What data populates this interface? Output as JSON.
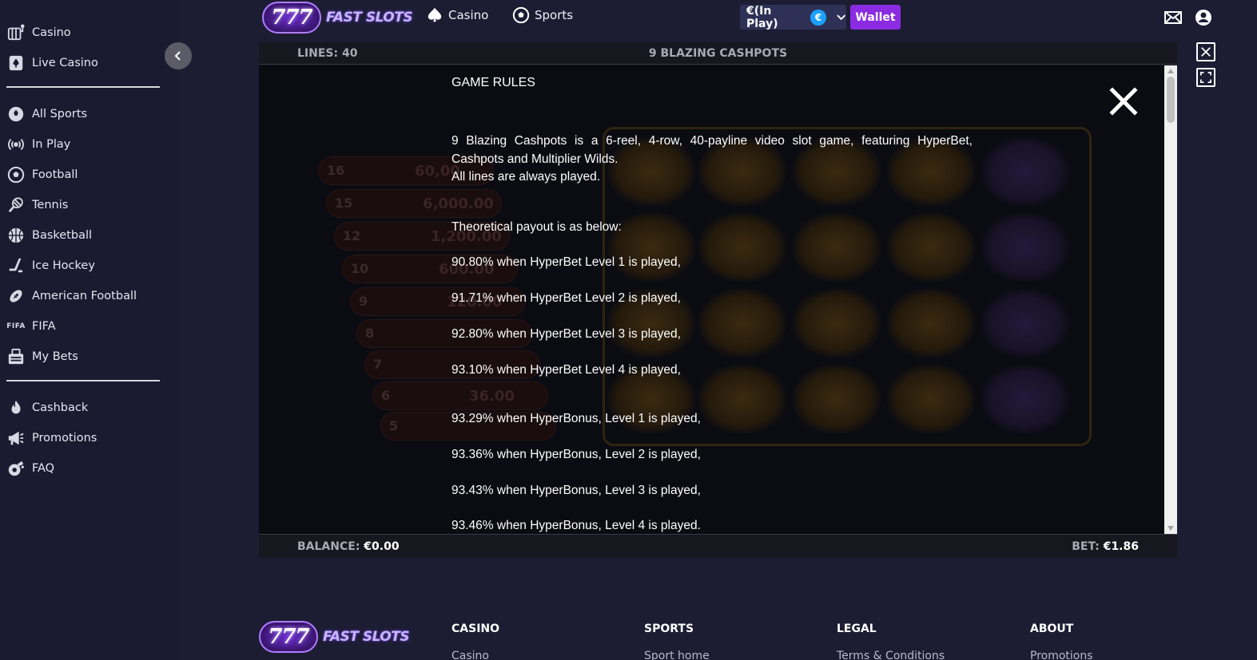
{
  "brand": {
    "logo_number": "777",
    "logo_text": "FAST SLOTS"
  },
  "sidebar": {
    "group1": [
      {
        "label": "Casino",
        "icon": "casino-icon"
      },
      {
        "label": "Live Casino",
        "icon": "live-casino-icon"
      }
    ],
    "group2": [
      {
        "label": "All Sports",
        "icon": "all-sports-icon"
      },
      {
        "label": "In Play",
        "icon": "in-play-icon"
      },
      {
        "label": "Football",
        "icon": "football-icon"
      },
      {
        "label": "Tennis",
        "icon": "tennis-icon"
      },
      {
        "label": "Basketball",
        "icon": "basketball-icon"
      },
      {
        "label": "Ice Hockey",
        "icon": "ice-hockey-icon"
      },
      {
        "label": "American Football",
        "icon": "american-football-icon"
      },
      {
        "label": "FIFA",
        "icon": "fifa-icon"
      },
      {
        "label": "My Bets",
        "icon": "my-bets-icon"
      }
    ],
    "group3": [
      {
        "label": "Cashback",
        "icon": "cashback-icon"
      },
      {
        "label": "Promotions",
        "icon": "promotions-icon"
      },
      {
        "label": "FAQ",
        "icon": "faq-icon"
      }
    ]
  },
  "topbar": {
    "casino_label": "Casino",
    "sports_label": "Sports",
    "inplay_label": "€(In Play)",
    "currency_symbol": "€",
    "wallet_label": "Wallet"
  },
  "game": {
    "lines_label": "LINES: 40",
    "title": "9 BLAZING CASHPOTS",
    "balance_label": "BALANCE:",
    "balance_value": "€0.00",
    "bet_label": "BET:",
    "bet_value": "€1.86",
    "background": {
      "ladder": [
        {
          "level": "16",
          "prize": "60,00"
        },
        {
          "level": "15",
          "prize": "6,000.00"
        },
        {
          "level": "12",
          "prize": "1,200.00"
        },
        {
          "level": "10",
          "prize": "600.00"
        },
        {
          "level": "9",
          "prize": "120.00"
        },
        {
          "level": "8",
          "prize": ""
        },
        {
          "level": "7",
          "prize": ""
        },
        {
          "level": "6",
          "prize": "36.00"
        },
        {
          "level": "5",
          "prize": ""
        }
      ]
    }
  },
  "rules": {
    "title": "GAME RULES",
    "intro": "9 Blazing Cashpots is a 6-reel, 4-row, 40-payline video slot game, featuring HyperBet, Cashpots and Multiplier Wilds.",
    "all_lines": "All lines are always played.",
    "payout_heading": "Theoretical payout is as below:",
    "payouts": [
      "90.80% when HyperBet Level 1 is played,",
      "91.71% when HyperBet Level 2 is played,",
      "92.80% when HyperBet Level 3 is played,",
      "93.10% when HyperBet Level 4 is played,",
      "93.29% when HyperBonus, Level 1 is played,",
      "93.36% when HyperBonus, Level 2 is played,",
      "93.43% when HyperBonus, Level 3 is played,",
      "93.46% when HyperBonus, Level 4 is played."
    ]
  },
  "footer": {
    "columns": [
      {
        "heading": "CASINO",
        "first_link": "Casino"
      },
      {
        "heading": "SPORTS",
        "first_link": "Sport home"
      },
      {
        "heading": "LEGAL",
        "first_link": "Terms & Conditions"
      },
      {
        "heading": "ABOUT",
        "first_link": "Promotions"
      }
    ]
  },
  "colors": {
    "accent": "#8a2be2",
    "euro_badge": "#1aa0ff",
    "background": "#1c1d33"
  }
}
